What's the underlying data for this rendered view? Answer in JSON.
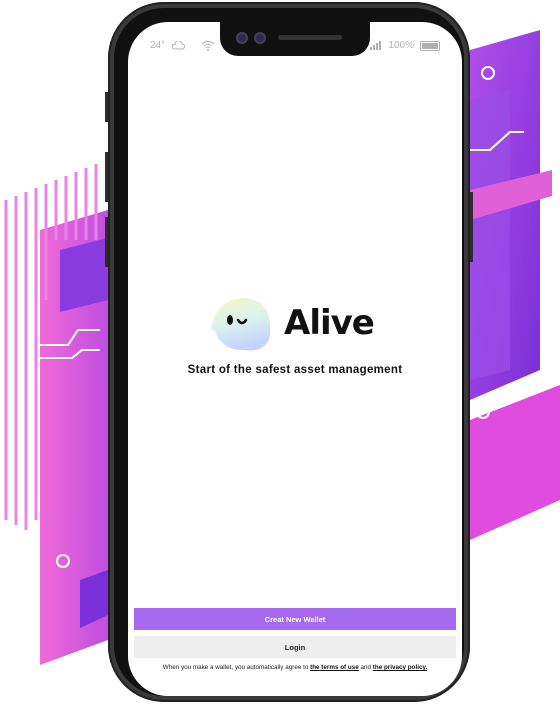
{
  "status_bar": {
    "temperature": "24°",
    "battery": "100%"
  },
  "app": {
    "brand": "Alive",
    "tagline": "Start of the safest asset management"
  },
  "buttons": {
    "create_wallet": "Creat New Wallet",
    "login": "Login"
  },
  "terms": {
    "prefix": "When you make a wallet, you automatically agree to ",
    "terms_link": "the terms of use",
    "conjunction": " and ",
    "privacy_link": "the privacy policy."
  },
  "colors": {
    "accent": "#a56af0",
    "background_purple": "#8a3be0",
    "background_pink": "#e04be0"
  }
}
